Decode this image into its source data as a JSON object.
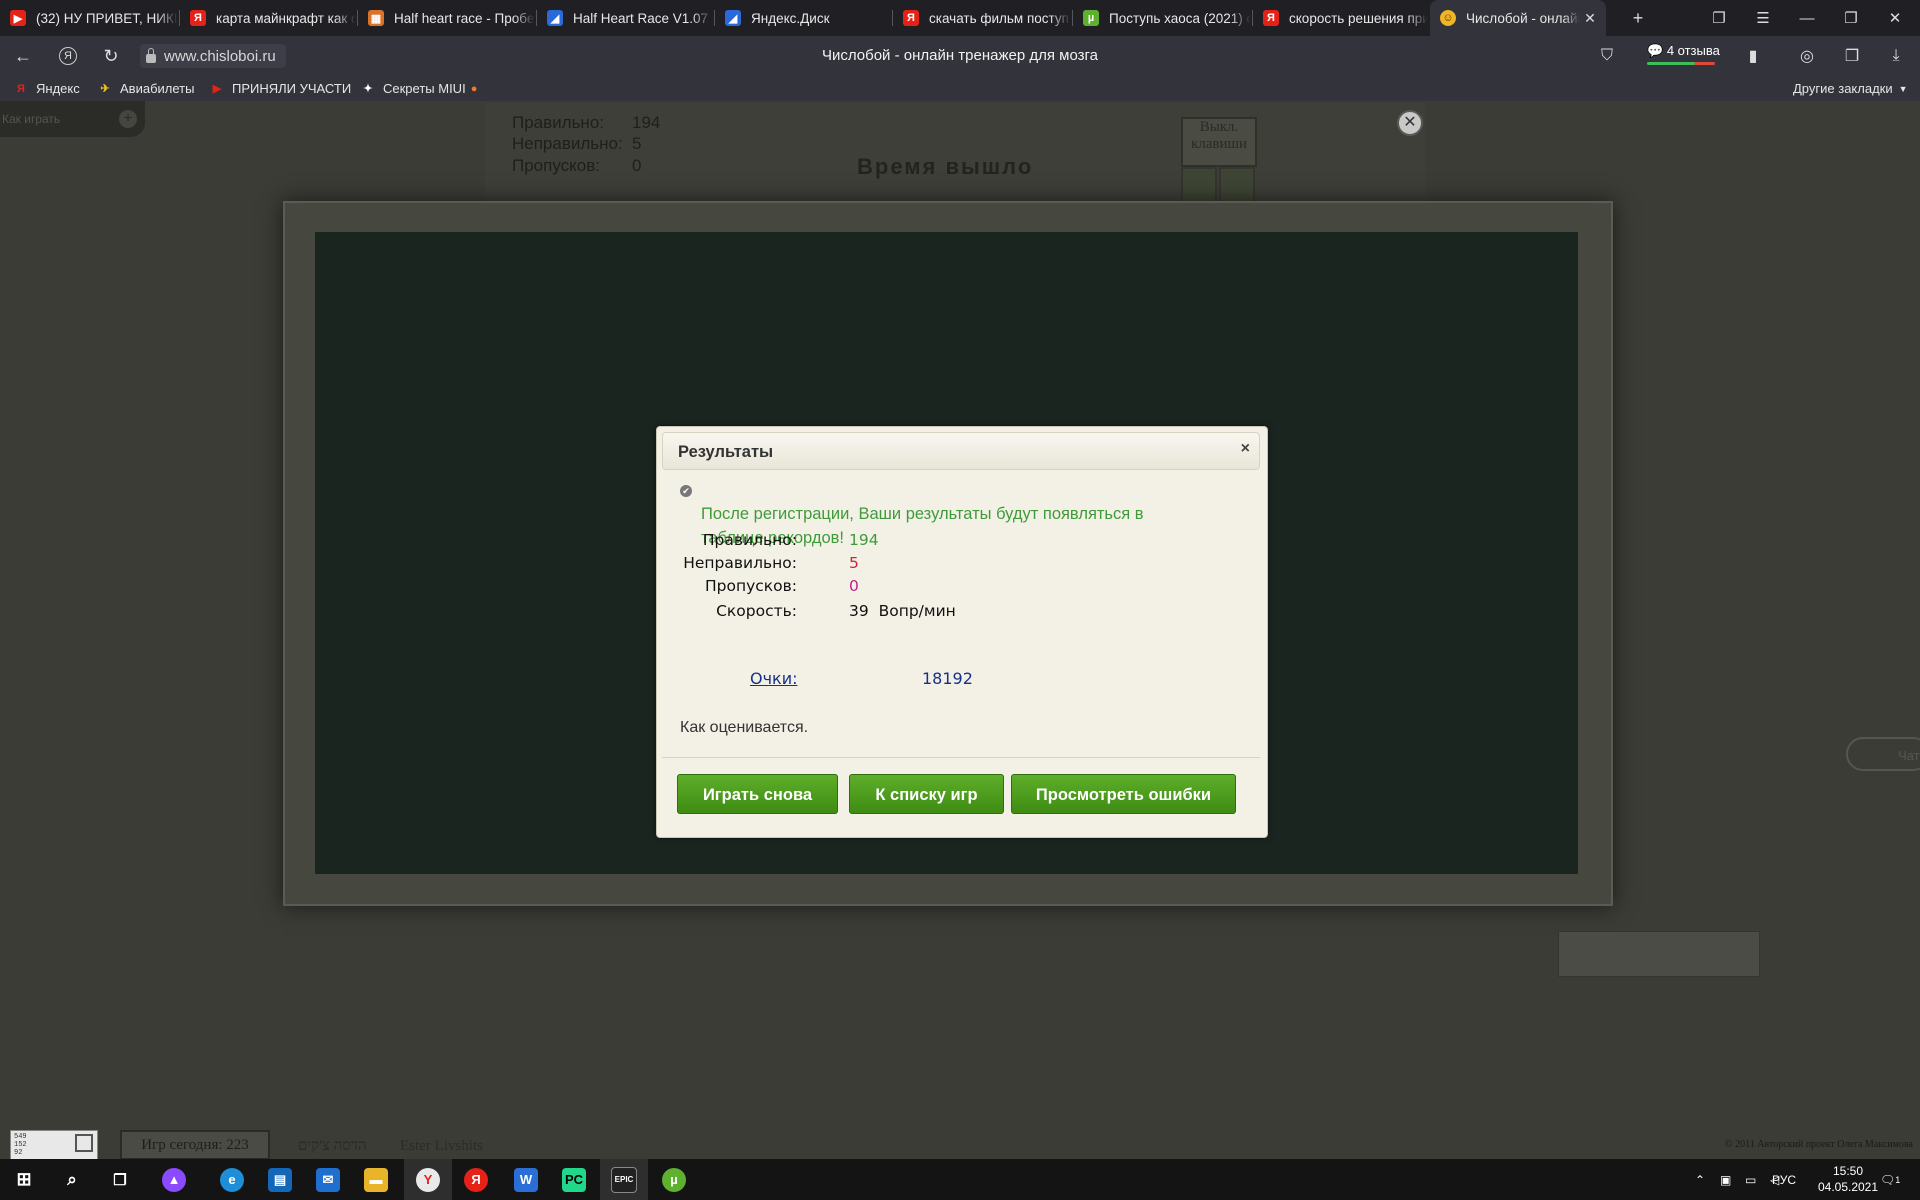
{
  "browser": {
    "tabs": [
      {
        "title": "(32) НУ ПРИВЕТ, НИКИТ",
        "icon": "youtube-icon",
        "color": "#e62117",
        "glyph": "▶"
      },
      {
        "title": "карта майнкрафт как с",
        "icon": "yandex-icon",
        "color": "#e62117",
        "glyph": "Я"
      },
      {
        "title": "Half heart race - Пробе",
        "icon": "minecraft-icon",
        "color": "#d8732a",
        "glyph": "▦"
      },
      {
        "title": "Half Heart Race V1.07 (",
        "icon": "blue-swoosh-icon",
        "color": "#2a6ad8",
        "glyph": "◢"
      },
      {
        "title": "Яндекс.Диск",
        "icon": "disk-icon",
        "color": "#2a6ad8",
        "glyph": "◢"
      },
      {
        "title": "скачать фильм поступ",
        "icon": "yandex-icon",
        "color": "#e62117",
        "glyph": "Я"
      },
      {
        "title": "Поступь хаоса (2021) с",
        "icon": "utorrent-icon",
        "color": "#5db12f",
        "glyph": "µ"
      },
      {
        "title": "скорость решения при",
        "icon": "yandex-icon",
        "color": "#e62117",
        "glyph": "Я"
      },
      {
        "title": "Числобой - онлайн тре",
        "icon": "chisloboi-icon",
        "color": "#f0b428",
        "glyph": "☺",
        "active": true
      }
    ],
    "url": "www.chisloboi.ru",
    "page_title": "Числобой - онлайн тренажер для мозга",
    "reviews": "4 отзыва",
    "bookmarks": [
      {
        "label": "Яндекс",
        "icon": "yandex-icon",
        "color": "#e62117",
        "glyph": "Я"
      },
      {
        "label": "Авиабилеты",
        "icon": "plane-icon",
        "color": "#f0c41c",
        "glyph": "✈"
      },
      {
        "label": "ПРИНЯЛИ УЧАСТИ",
        "icon": "youtube-icon",
        "color": "#e62117",
        "glyph": "▶"
      },
      {
        "label": "Секреты MIUI",
        "icon": "sparkle-icon",
        "color": "#ffffff",
        "glyph": "✦"
      }
    ],
    "other_bookmarks": "Другие закладки"
  },
  "page": {
    "how_to_play": "Как играть",
    "stats": {
      "correct_label": "Правильно:",
      "correct_value": "194",
      "wrong_label": "Неправильно:",
      "wrong_value": "5",
      "skipped_label": "Пропусков:",
      "skipped_value": "0"
    },
    "time_out": "Время вышло",
    "keyboard_button": "Выкл. клавиши",
    "chat": "Чат",
    "footer": {
      "counter_lines": [
        "549",
        "152",
        "92"
      ],
      "games_today": "Игр сегодня: 223",
      "name_hebrew": "הדסה צ'קים",
      "name_latin": "Ester Livshits",
      "copyright": "© 2011 Авторский проект Олега Максимова"
    }
  },
  "modal": {
    "title": "Результаты",
    "close": "×",
    "notice": "После регистрации, Ваши результаты будут появляться в таблице рекордов!",
    "rows": [
      {
        "label": "Правильно:",
        "value": "194",
        "color": "#3f9b3a"
      },
      {
        "label": "Неправильно:",
        "value": "5",
        "color": "#d21f3c"
      },
      {
        "label": "Пропусков:",
        "value": "0",
        "color": "#c21e8a"
      },
      {
        "label": "Скорость:",
        "value": "39  Вопр/мин",
        "color": "#111111"
      }
    ],
    "score_label": "Очки:",
    "score_value": "18192",
    "how_rated": "Как оценивается.",
    "buttons": {
      "play_again": "Играть снова",
      "to_games": "К списку игр",
      "view_errors": "Просмотреть ошибки"
    }
  },
  "taskbar": {
    "lang": "РУС",
    "time": "15:50",
    "date": "04.05.2021",
    "notifications": "1"
  }
}
